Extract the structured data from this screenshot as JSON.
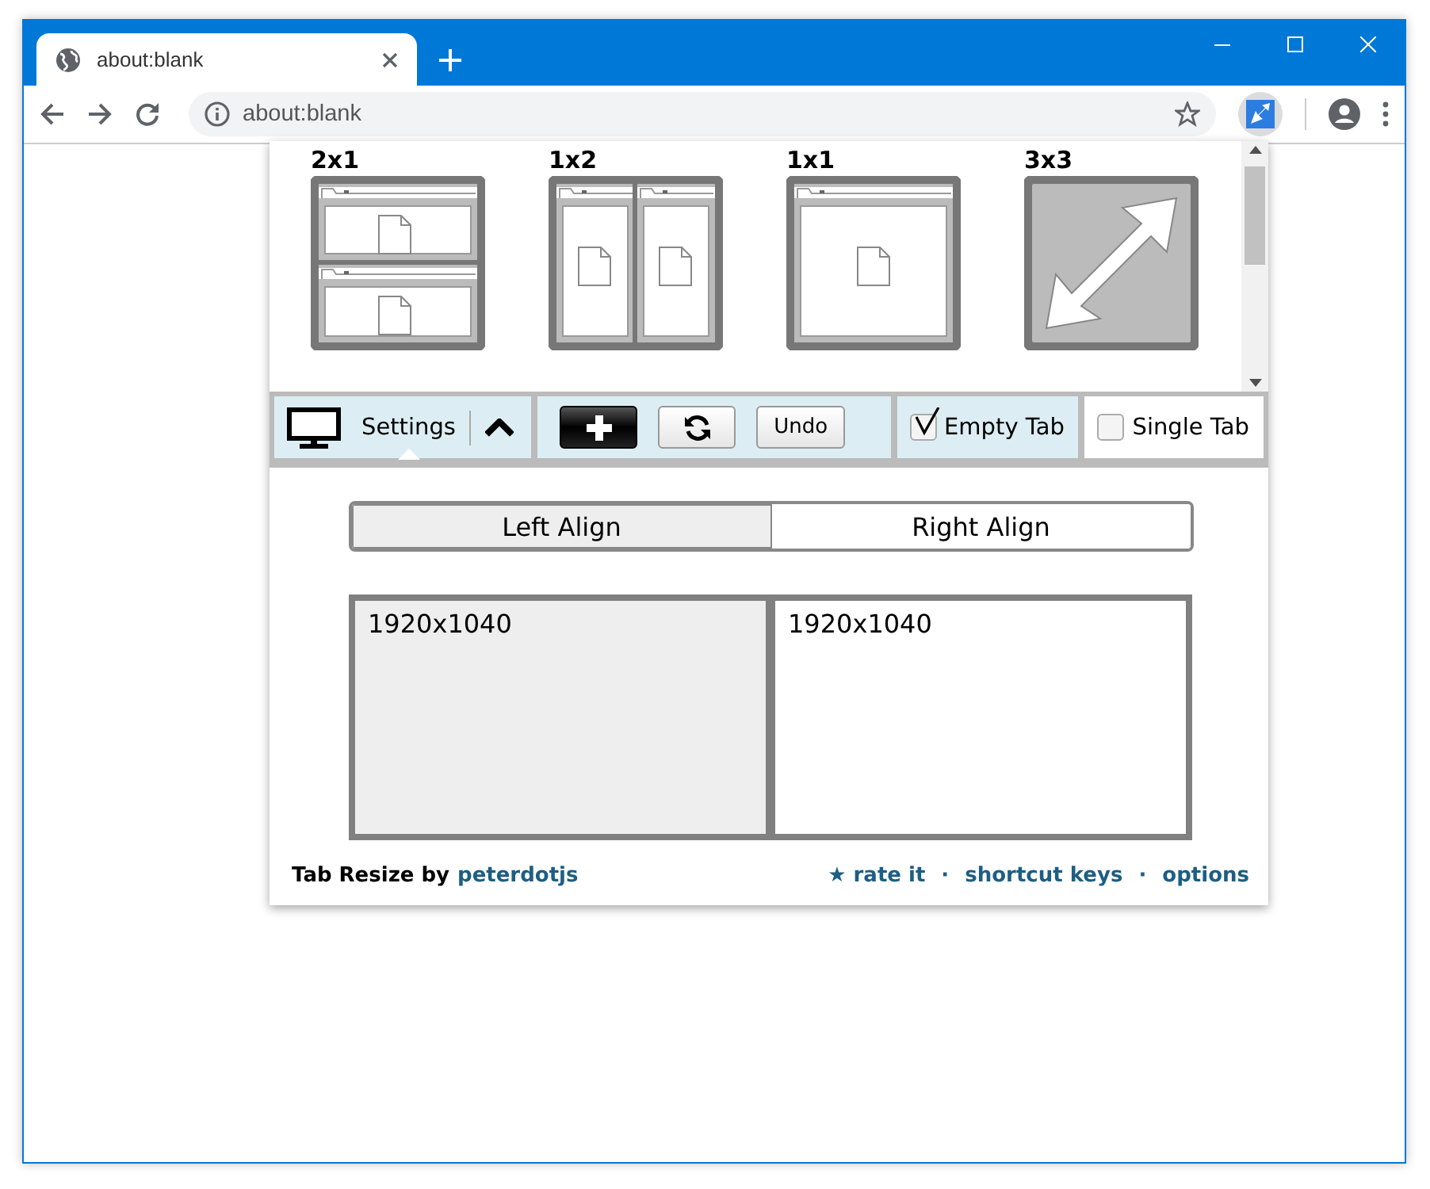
{
  "browser": {
    "tab_title": "about:blank",
    "address": "about:blank"
  },
  "layouts": [
    {
      "label": "2x1",
      "kind": "rows"
    },
    {
      "label": "1x2",
      "kind": "columns"
    },
    {
      "label": "1x1",
      "kind": "single"
    },
    {
      "label": "3x3",
      "kind": "resize"
    }
  ],
  "toolbar": {
    "settings_label": "Settings",
    "undo_label": "Undo",
    "options": [
      {
        "label": "Empty Tab",
        "checked": true
      },
      {
        "label": "Single Tab",
        "checked": false
      }
    ]
  },
  "align": [
    {
      "label": "Left Align",
      "selected": true
    },
    {
      "label": "Right Align",
      "selected": false
    }
  ],
  "displays": [
    {
      "label": "1920x1040",
      "selected": true
    },
    {
      "label": "1920x1040",
      "selected": false
    }
  ],
  "footer": {
    "credit": "Tab Resize by",
    "author": "peterdotjs",
    "separator": "·",
    "links": [
      "★ rate it",
      "shortcut keys",
      "options"
    ]
  }
}
